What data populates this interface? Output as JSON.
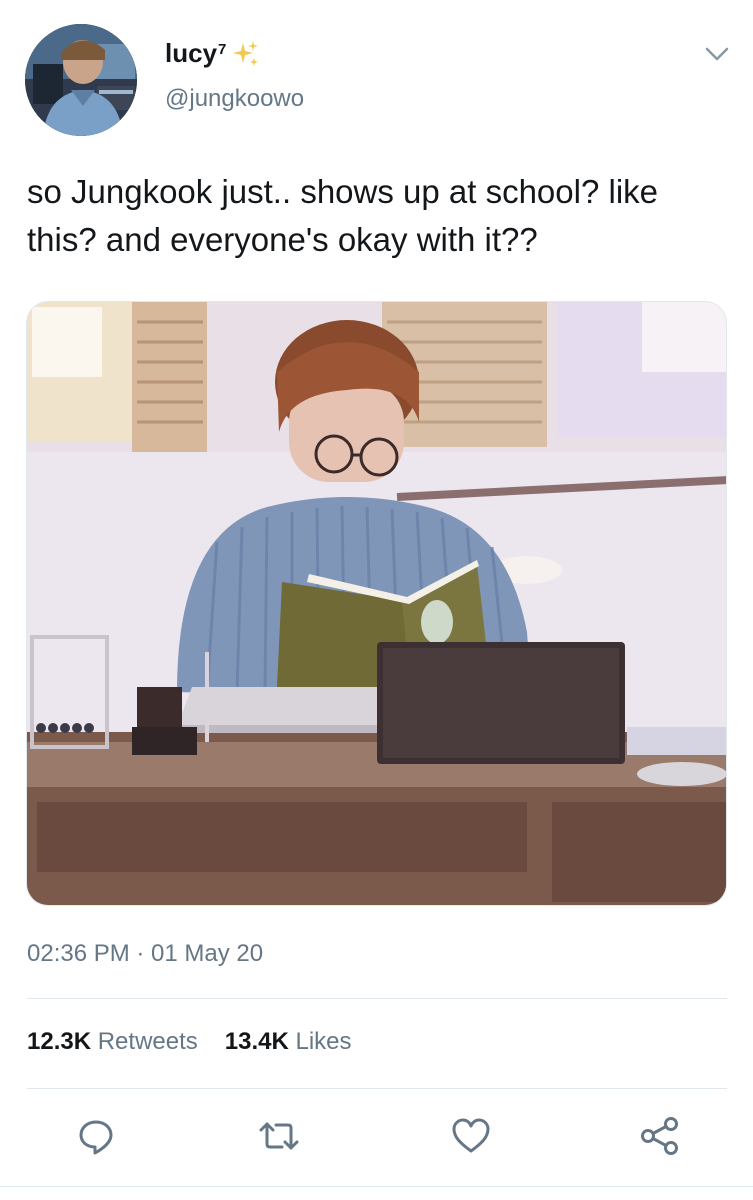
{
  "author": {
    "display_name": "lucy",
    "superscript": "7",
    "handle": "@jungkoowo",
    "avatar_icon": "avatar"
  },
  "tweet": {
    "text": "so Jungkook just.. shows up at school? like this? and everyone's okay with it??",
    "timestamp": "02:36 PM · 01 May 20"
  },
  "stats": {
    "retweets_count": "12.3K",
    "retweets_label": "Retweets",
    "likes_count": "13.4K",
    "likes_label": "Likes"
  },
  "actions": [
    {
      "icon": "reply-icon"
    },
    {
      "icon": "retweet-icon"
    },
    {
      "icon": "like-icon"
    },
    {
      "icon": "share-icon"
    }
  ],
  "colors": {
    "text_primary": "#14171a",
    "text_secondary": "#657786",
    "divider": "#e1e8ed",
    "sparkle": "#f2c94c"
  }
}
